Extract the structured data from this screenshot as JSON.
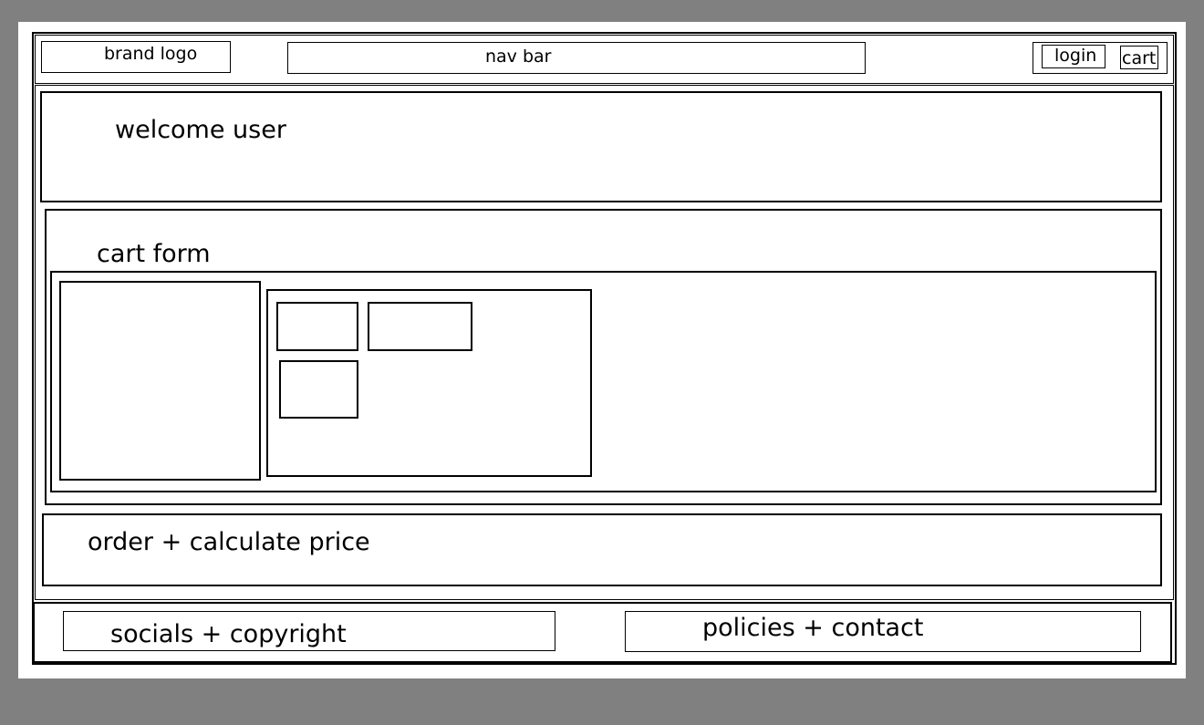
{
  "header": {
    "brand_logo": "brand logo",
    "nav_bar": "nav bar",
    "login": "login",
    "cart": "cart"
  },
  "welcome": {
    "text": "welcome user"
  },
  "cart_form": {
    "title": "cart form"
  },
  "order": {
    "text": "order + calculate price"
  },
  "footer": {
    "socials": "socials + copyright",
    "policies": "policies + contact"
  }
}
